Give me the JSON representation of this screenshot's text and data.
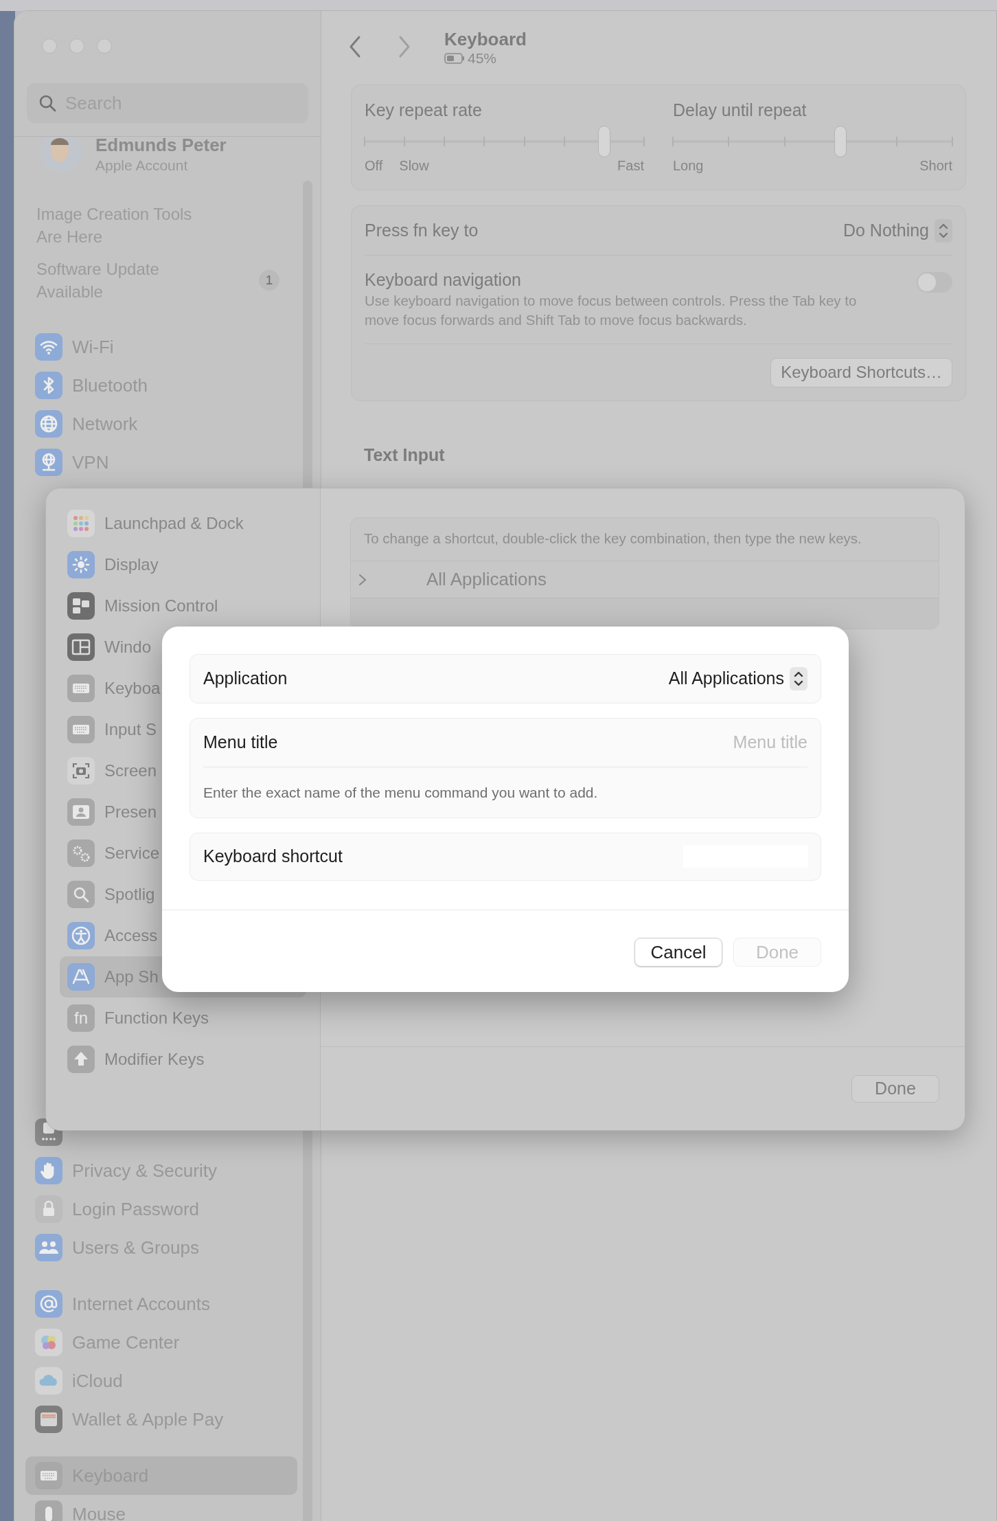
{
  "window": {
    "title": "Keyboard",
    "battery": "45%"
  },
  "sidebar": {
    "search_placeholder": "Search",
    "account": {
      "name": "Edmunds Peter",
      "subtitle": "Apple Account"
    },
    "notices": [
      {
        "text": "Image Creation Tools Are Here"
      },
      {
        "text": "Software Update Available",
        "badge": "1"
      }
    ],
    "top_items": [
      {
        "label": "Wi-Fi",
        "selected": false
      },
      {
        "label": "Bluetooth",
        "selected": false
      },
      {
        "label": "Network",
        "selected": false
      },
      {
        "label": "VPN",
        "selected": false
      }
    ],
    "bottom_groups": [
      [
        {
          "label": "Privacy & Security",
          "selected": false
        },
        {
          "label": "Login Password",
          "selected": false
        },
        {
          "label": "Users & Groups",
          "selected": false
        }
      ],
      [
        {
          "label": "Internet Accounts",
          "selected": false
        },
        {
          "label": "Game Center",
          "selected": false
        },
        {
          "label": "iCloud",
          "selected": false
        },
        {
          "label": "Wallet & Apple Pay",
          "selected": false
        }
      ],
      [
        {
          "label": "Keyboard",
          "selected": true
        },
        {
          "label": "Mouse",
          "selected": false
        }
      ]
    ]
  },
  "sliders": [
    {
      "label": "Key repeat rate",
      "level": 0.857,
      "scale": [
        "Off",
        "Slow",
        "Fast"
      ]
    },
    {
      "label": "Delay until repeat",
      "level": 0.6,
      "scale": [
        "Long",
        "Short"
      ]
    }
  ],
  "fn_key": {
    "label": "Press fn key to",
    "value": "Do Nothing"
  },
  "keyboard_navigation": {
    "label": "Keyboard navigation",
    "description": "Use keyboard navigation to move focus between controls. Press the Tab key to move focus forwards and Shift Tab to move focus backwards.",
    "on": false
  },
  "shortcuts_button": "Keyboard Shortcuts…",
  "section_heading": "Text Input",
  "sheet": {
    "sidebar": [
      {
        "label": "Launchpad & Dock",
        "selected": false
      },
      {
        "label": "Display",
        "selected": false
      },
      {
        "label": "Mission Control",
        "selected": false
      },
      {
        "label": "Windo",
        "selected": false
      },
      {
        "label": "Keyboa",
        "selected": false
      },
      {
        "label": "Input S",
        "selected": false
      },
      {
        "label": "Screen",
        "selected": false
      },
      {
        "label": "Presen",
        "selected": false
      },
      {
        "label": "Service",
        "selected": false
      },
      {
        "label": "Spotlig",
        "selected": false
      },
      {
        "label": "Access",
        "selected": false
      },
      {
        "label": "App Sh",
        "selected": true
      },
      {
        "label": "Function Keys",
        "selected": false,
        "icon_text": "fn"
      },
      {
        "label": "Modifier Keys",
        "selected": false
      }
    ],
    "info": "To change a shortcut, double-click the key combination, then type the new keys.",
    "rows": [
      {
        "label": "All Applications",
        "expanded": false
      }
    ],
    "done": "Done"
  },
  "dialog": {
    "application": {
      "label": "Application",
      "value": "All Applications"
    },
    "menu_title": {
      "label": "Menu title",
      "placeholder": "Menu title",
      "help": "Enter the exact name of the menu command you want to add."
    },
    "shortcut": {
      "label": "Keyboard shortcut"
    },
    "buttons": [
      {
        "label": "Cancel",
        "disabled": false
      },
      {
        "label": "Done",
        "disabled": true
      }
    ]
  }
}
